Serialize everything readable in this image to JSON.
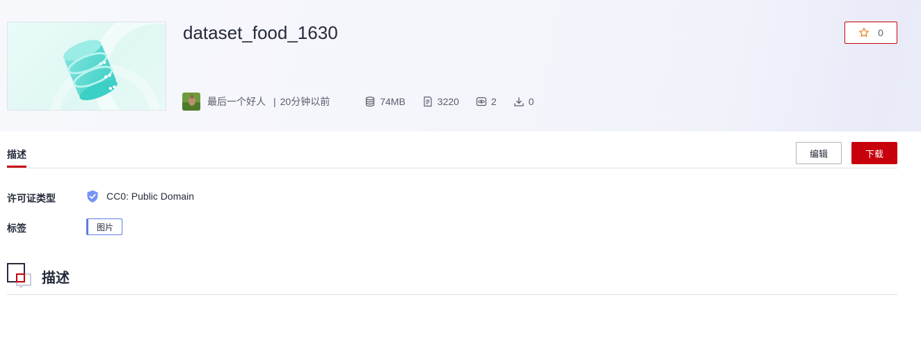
{
  "dataset": {
    "title": "dataset_food_1630",
    "star_count": "0",
    "author": "最后一个好人",
    "separator": "|",
    "time": "20分钟以前",
    "size": "74MB",
    "files": "3220",
    "views": "2",
    "downloads": "0"
  },
  "tabs": {
    "description_tab": "描述"
  },
  "actions": {
    "edit_label": "编辑",
    "download_label": "下载"
  },
  "info": {
    "license_label": "许可证类型",
    "license_value": "CC0: Public Domain",
    "tags_label": "标签",
    "tags": [
      "图片"
    ]
  },
  "section": {
    "description_title": "描述"
  },
  "icons": {
    "star": "star-icon",
    "size": "database-icon",
    "files": "document-icon",
    "views": "eye-icon",
    "downloads": "download-icon",
    "license": "shield-check-icon",
    "section": "description-section-icon"
  },
  "colors": {
    "brand_red": "#c7000b",
    "tag_blue": "#5e7ce0",
    "text": "#252b3a",
    "muted": "#575d6c"
  }
}
